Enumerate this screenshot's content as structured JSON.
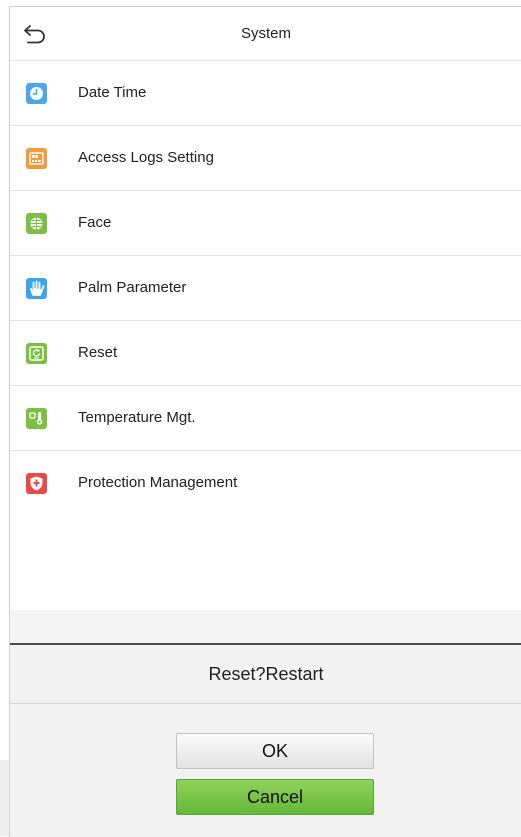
{
  "header": {
    "title": "System"
  },
  "menu": {
    "items": [
      {
        "label": "Date Time",
        "icon": "clock-icon",
        "color": "#4aa8ea"
      },
      {
        "label": "Access Logs Setting",
        "icon": "logs-icon",
        "color": "#f39a3b"
      },
      {
        "label": "Face",
        "icon": "face-icon",
        "color": "#7bc043"
      },
      {
        "label": "Palm Parameter",
        "icon": "palm-icon",
        "color": "#3aa6e8"
      },
      {
        "label": "Reset",
        "icon": "reset-icon",
        "color": "#7bc043"
      },
      {
        "label": "Temperature Mgt.",
        "icon": "thermometer-icon",
        "color": "#7bc043"
      },
      {
        "label": "Protection Management",
        "icon": "shield-icon",
        "color": "#e84a4a"
      }
    ]
  },
  "dialog": {
    "title": "Reset?Restart",
    "ok_label": "OK",
    "cancel_label": "Cancel"
  }
}
